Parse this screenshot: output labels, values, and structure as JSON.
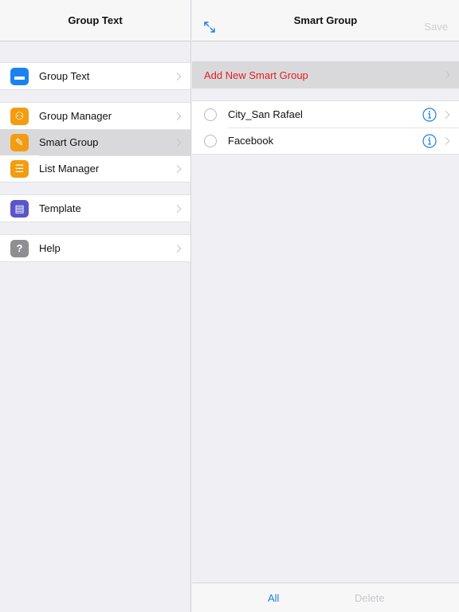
{
  "master": {
    "title": "Group Text",
    "groups": [
      [
        {
          "label": "Group Text",
          "icon": "message-bubble-icon",
          "color": "#1a82f0",
          "glyph": "▬"
        }
      ],
      [
        {
          "label": "Group Manager",
          "icon": "people-icon",
          "color": "#f39c12",
          "glyph": "⚇"
        },
        {
          "label": "Smart Group",
          "icon": "pencil-icon",
          "color": "#f39c12",
          "glyph": "✎",
          "selected": true
        },
        {
          "label": "List Manager",
          "icon": "list-icon",
          "color": "#f39c12",
          "glyph": "☰"
        }
      ],
      [
        {
          "label": "Template",
          "icon": "document-icon",
          "color": "#5b55c9",
          "glyph": "▤"
        }
      ],
      [
        {
          "label": "Help",
          "icon": "question-icon",
          "color": "#8e8e93",
          "glyph": "?"
        }
      ]
    ]
  },
  "detail": {
    "title": "Smart Group",
    "save_label": "Save",
    "add_label": "Add New Smart Group",
    "rows": [
      {
        "label": "City_San Rafael"
      },
      {
        "label": "Facebook"
      }
    ],
    "toolbar": {
      "all_label": "All",
      "delete_label": "Delete"
    }
  },
  "colors": {
    "accent": "#1a7ee8",
    "add_red": "#e02020",
    "disabled": "#c9c9ce"
  }
}
